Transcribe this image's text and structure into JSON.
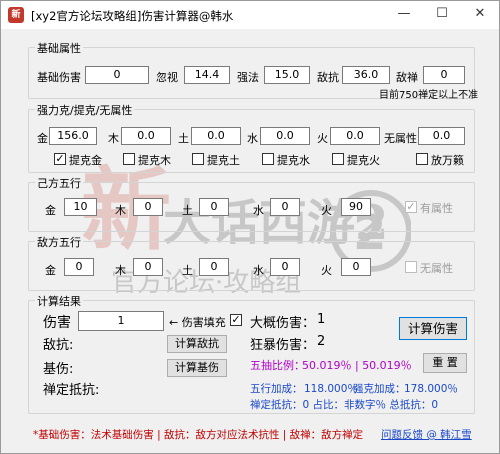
{
  "window": {
    "title": "[xy2官方论坛攻略组]伤害计算器@韩水",
    "icon_glyph": "新",
    "minimize": "—",
    "maximize": "☐",
    "close": "✕"
  },
  "watermark": {
    "main": "大话西游2",
    "big_char": "新",
    "sub": "官方论坛·攻略组",
    "num": "2"
  },
  "basic": {
    "title": "基础属性",
    "fields": [
      {
        "label": "基础伤害",
        "value": "0"
      },
      {
        "label": "忽视",
        "value": "14.4"
      },
      {
        "label": "强法",
        "value": "15.0"
      },
      {
        "label": "敌抗",
        "value": "36.0"
      },
      {
        "label": "敌禅",
        "value": "0"
      }
    ],
    "note": "目前750禅定以上不准"
  },
  "elements": {
    "title": "强力克/提克/无属性",
    "fields": [
      {
        "label": "金",
        "value": "156.0"
      },
      {
        "label": "木",
        "value": "0.0"
      },
      {
        "label": "土",
        "value": "0.0"
      },
      {
        "label": "水",
        "value": "0.0"
      },
      {
        "label": "火",
        "value": "0.0"
      },
      {
        "label": "无属性",
        "value": "0.0"
      }
    ],
    "checks": [
      {
        "label": "提克金",
        "checked": true,
        "mark": "✓"
      },
      {
        "label": "提克木",
        "checked": false,
        "mark": ""
      },
      {
        "label": "提克土",
        "checked": false,
        "mark": ""
      },
      {
        "label": "提克水",
        "checked": false,
        "mark": ""
      },
      {
        "label": "提克火",
        "checked": false,
        "mark": ""
      },
      {
        "label": "放万籁",
        "checked": false,
        "mark": ""
      }
    ]
  },
  "self_five": {
    "title": "己方五行",
    "fields": [
      {
        "label": "金",
        "value": "10"
      },
      {
        "label": "木",
        "value": "0"
      },
      {
        "label": "土",
        "value": "0"
      },
      {
        "label": "水",
        "value": "0"
      },
      {
        "label": "火",
        "value": "90"
      }
    ],
    "check": {
      "label": "有属性",
      "mark": "✓"
    }
  },
  "enemy_five": {
    "title": "敌方五行",
    "fields": [
      {
        "label": "金",
        "value": "0"
      },
      {
        "label": "木",
        "value": "0"
      },
      {
        "label": "土",
        "value": "0"
      },
      {
        "label": "水",
        "value": "0"
      },
      {
        "label": "火",
        "value": "0"
      }
    ],
    "check": {
      "label": "无属性",
      "mark": ""
    }
  },
  "result": {
    "title": "计算结果",
    "damage_label": "伤害",
    "damage_value": "1",
    "arrow_label": "← 伤害填充",
    "fill_mark": "✓",
    "approx_label": "大概伤害：",
    "approx_value": "1",
    "crit_label": "狂暴伤害：",
    "crit_value": "2",
    "calc_button": "计算伤害",
    "enemy_res_label": "敌抗:",
    "calc_enemy_res_button": "计算敌抗",
    "base_dmg_label": "基伤:",
    "calc_base_button": "计算基伤",
    "zen_label": "禅定抵抗:",
    "ratio_label": "五抽比例：",
    "ratio_value": "50.019％ | 50.019％",
    "reset_button": "重 置",
    "five_bonus_label": "五行加成：",
    "five_bonus_value": "118.000％",
    "strong_bonus_label": "强克加成：",
    "strong_bonus_value": "178.000％",
    "zen_line": "禅定抵抗：0  占比：非数字％ 总抵抗：0"
  },
  "footer": {
    "note": "*基础伤害：法术基础伤害 | 敌抗：敌方对应法术抗性 | 敌禅：敌方禅定",
    "link": "问题反馈 @ 韩江雪"
  }
}
